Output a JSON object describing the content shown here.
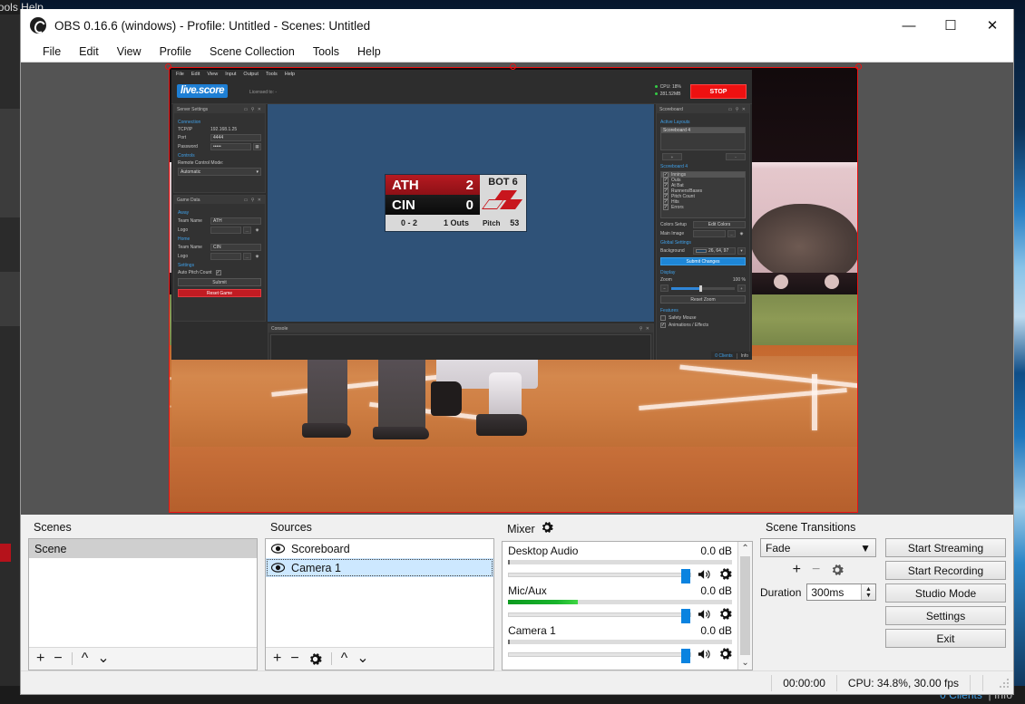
{
  "window": {
    "title": "OBS 0.16.6 (windows) - Profile: Untitled - Scenes: Untitled",
    "minimize": "—",
    "maximize": "☐",
    "close": "✕",
    "app_icon": "obs-logo-icon"
  },
  "menubar": {
    "items": [
      "File",
      "Edit",
      "View",
      "Profile",
      "Scene Collection",
      "Tools",
      "Help"
    ]
  },
  "background_window": {
    "partial_menu": "utput   Tools   Help"
  },
  "preview": {
    "source_selected": "Camera 1",
    "livescore": {
      "menu": [
        "File",
        "Edit",
        "View",
        "Input",
        "Output",
        "Tools",
        "Help"
      ],
      "logo": "live.score",
      "licensed_to_label": "Licensed to:",
      "licensed_to_value": "-",
      "cpu_label": "CPU: 18%",
      "mem_label": "281.52MB",
      "stop_button": "STOP",
      "server_settings": {
        "title": "Server Settings",
        "window_buttons": "▭ ⚲ ✕",
        "connection_group": "Connection",
        "tcpip_label": "TCP/IP",
        "tcpip_value": "192.168.1.25",
        "port_label": "Port",
        "port_value": "4444",
        "password_label": "Password",
        "password_value": "•••••",
        "qr_icon": "qr-code-icon",
        "controls_group": "Controls",
        "remote_control_label": "Remote Control Mode:",
        "remote_control_value": "Automatic"
      },
      "game_data": {
        "title": "Game Data",
        "window_buttons": "▭ ⚲ ✕",
        "away_group": "Away",
        "away_team_label": "Team Name",
        "away_team_value": "ATH",
        "away_logo_label": "Logo",
        "away_logo_value": "",
        "home_group": "Home",
        "home_team_label": "Team Name",
        "home_team_value": "CIN",
        "home_logo_label": "Logo",
        "home_logo_value": "",
        "settings_group": "Settings",
        "auto_pitch_label": "Auto Pitch Count",
        "auto_pitch_checked": true,
        "submit_button": "Submit",
        "reset_button": "Reset Game"
      },
      "scoreboard_panel": {
        "title": "Scoreboard",
        "window_buttons": "▭ ⚲ ✕",
        "active_layouts_group": "Active Layouts",
        "active_layout_selected": "Scoreboard 4",
        "add_button": "+",
        "remove_button": "-",
        "layout_group": "Scoreboard 4",
        "elements": [
          {
            "label": "Innings",
            "checked": true,
            "selected": true
          },
          {
            "label": "Outs",
            "checked": true,
            "selected": false
          },
          {
            "label": "At Bat",
            "checked": true,
            "selected": false
          },
          {
            "label": "Runners/Bases",
            "checked": true,
            "selected": false
          },
          {
            "label": "Pitch Count",
            "checked": true,
            "selected": false
          },
          {
            "label": "Hits",
            "checked": true,
            "selected": false
          },
          {
            "label": "Errors",
            "checked": true,
            "selected": false
          }
        ],
        "colors_setup_label": "Colors Setup",
        "edit_colors_button": "Edit Colors",
        "main_image_label": "Main Image",
        "main_image_value": "",
        "global_settings_group": "Global Settings",
        "background_label": "Background",
        "background_value": "26, 64, 97",
        "submit_changes_button": "Submit Changes",
        "display_group": "Display",
        "zoom_label": "Zoom",
        "zoom_value": "100 %",
        "zoom_minus": "−",
        "zoom_plus": "+",
        "reset_zoom_button": "Reset Zoom",
        "features_group": "Features",
        "safety_mouse_label": "Safety Mouse",
        "safety_mouse_checked": false,
        "animations_label": "Animations / Effects",
        "animations_checked": true
      },
      "console": {
        "title": "Console",
        "window_buttons": "⚲ ✕",
        "content": ""
      },
      "status": {
        "clients": "0 Clients",
        "info": "Info"
      }
    },
    "scoreboard_graphic": {
      "away_team": "ATH",
      "away_score": "2",
      "home_team": "CIN",
      "home_score": "0",
      "inning": "BOT 6",
      "count": "0 - 2",
      "outs": "1 Outs",
      "pitch_label": "Pitch",
      "pitch_count": "53",
      "bases_filled": 2
    }
  },
  "scenes": {
    "title": "Scenes",
    "items": [
      {
        "label": "Scene",
        "selected": true
      }
    ],
    "tools": {
      "add": "+",
      "remove": "−",
      "up": "^",
      "down": "⌄"
    }
  },
  "sources": {
    "title": "Sources",
    "items": [
      {
        "label": "Scoreboard",
        "visible": true,
        "selected": false
      },
      {
        "label": "Camera 1",
        "visible": true,
        "selected": true
      }
    ],
    "tools": {
      "add": "+",
      "remove": "−",
      "properties": "gear-icon",
      "up": "^",
      "down": "⌄"
    }
  },
  "mixer": {
    "title": "Mixer",
    "settings_icon": "gear-icon",
    "channels": [
      {
        "name": "Desktop Audio",
        "db": "0.0 dB",
        "level_pct": 0,
        "volume_pct": 100
      },
      {
        "name": "Mic/Aux",
        "db": "0.0 dB",
        "level_pct": 30,
        "volume_pct": 100
      },
      {
        "name": "Camera 1",
        "db": "0.0 dB",
        "level_pct": 0,
        "volume_pct": 100
      }
    ],
    "scroll_up": "⌃",
    "scroll_down": "⌄"
  },
  "transitions": {
    "title": "Scene Transitions",
    "selected": "Fade",
    "dropdown_arrow": "▼",
    "add": "+",
    "remove": "−",
    "properties": "gear-icon",
    "duration_label": "Duration",
    "duration_value": "300ms",
    "spin_up": "▲",
    "spin_down": "▼"
  },
  "controls": {
    "start_streaming": "Start Streaming",
    "start_recording": "Start Recording",
    "studio_mode": "Studio Mode",
    "settings": "Settings",
    "exit": "Exit"
  },
  "statusbar": {
    "timer": "00:00:00",
    "cpu": "CPU: 34.8%, 30.00 fps"
  },
  "taskbar_behind": {
    "clients": "0 Clients",
    "info": "Info"
  },
  "colors": {
    "accent_blue": "#0a83e0",
    "stop_red": "#ee1111",
    "selection_blue": "#cde8ff",
    "scoreboard_red": "#b61a21"
  }
}
